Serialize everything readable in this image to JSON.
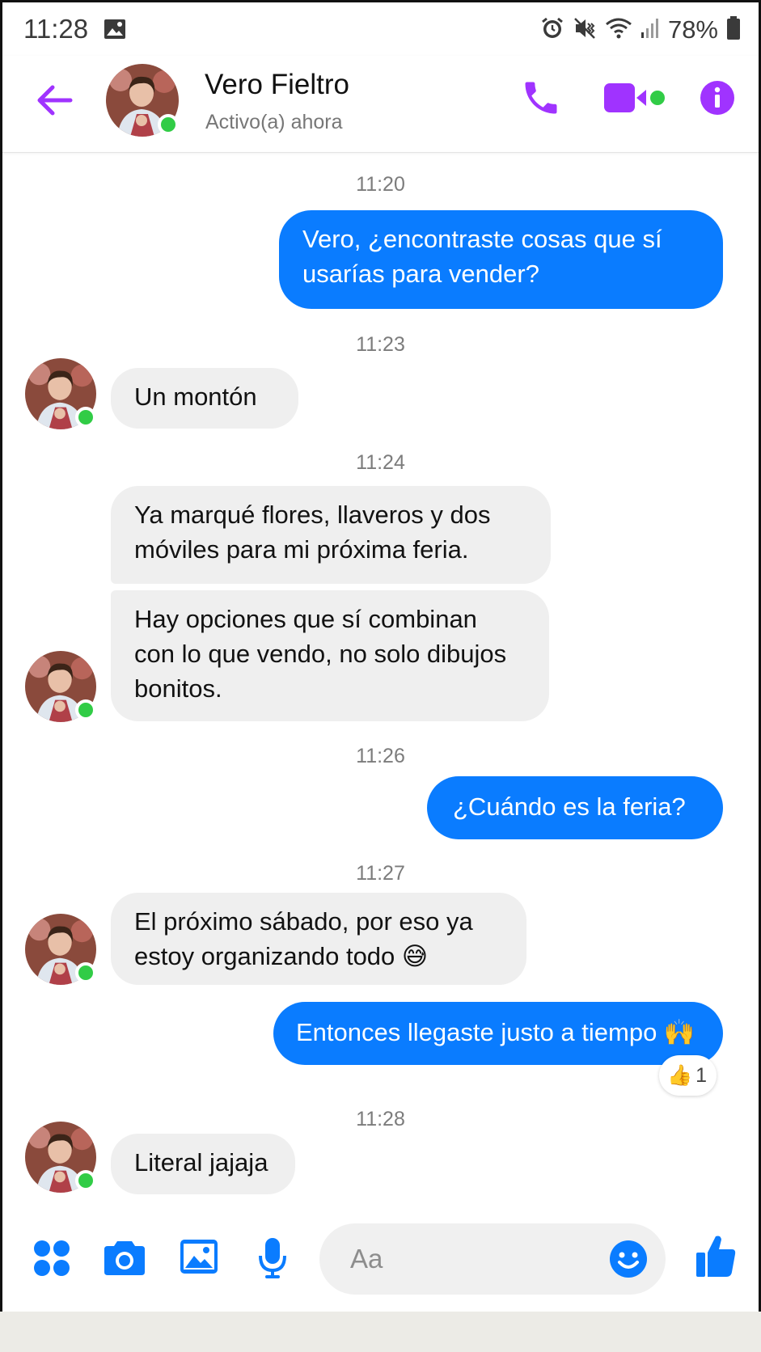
{
  "status_bar": {
    "time": "11:28",
    "battery": "78%",
    "icons": [
      "gallery-icon",
      "alarm-icon",
      "mute-vibrate-icon",
      "wifi-icon",
      "signal-icon",
      "battery-icon"
    ]
  },
  "header": {
    "contact_name": "Vero Fieltro",
    "contact_status": "Activo(a) ahora",
    "icons": [
      "back-arrow-icon",
      "phone-icon",
      "video-camera-icon",
      "info-icon"
    ]
  },
  "messages": [
    {
      "type": "timestamp",
      "text": "11:20"
    },
    {
      "type": "outgoing",
      "lines": [
        "Vero, ¿encontraste cosas que sí",
        "usarías para vender?"
      ]
    },
    {
      "type": "timestamp",
      "text": "11:23"
    },
    {
      "type": "incoming",
      "lines": [
        "Un montón"
      ]
    },
    {
      "type": "timestamp",
      "text": "11:24"
    },
    {
      "type": "incoming",
      "lines": [
        "Ya marqué flores, llaveros y dos",
        "móviles para mi próxima feria."
      ]
    },
    {
      "type": "incoming",
      "lines": [
        "Hay opciones que sí combinan",
        "con lo que vendo, no solo dibujos",
        "bonitos."
      ]
    },
    {
      "type": "timestamp",
      "text": "11:26"
    },
    {
      "type": "outgoing",
      "lines": [
        "¿Cuándo es la feria?"
      ]
    },
    {
      "type": "timestamp",
      "text": "11:27"
    },
    {
      "type": "incoming",
      "lines": [
        "El próximo sábado, por eso ya",
        "estoy organizando todo 😅"
      ]
    },
    {
      "type": "outgoing",
      "lines": [
        "Entonces llegaste justo a tiempo 🙌"
      ],
      "reaction": {
        "emoji": "👍",
        "count": "1"
      }
    },
    {
      "type": "timestamp",
      "text": "11:28"
    },
    {
      "type": "incoming",
      "lines": [
        "Literal jajaja"
      ]
    }
  ],
  "composer": {
    "placeholder": "Aa",
    "icons": [
      "apps-grid-icon",
      "camera-icon",
      "gallery-icon",
      "microphone-icon",
      "emoji-icon",
      "thumbs-up-icon"
    ]
  },
  "colors": {
    "accent": "#a033ff",
    "outgoing_bubble": "#0a7cff",
    "incoming_bubble": "#efefef",
    "online_dot": "#31cc46"
  }
}
